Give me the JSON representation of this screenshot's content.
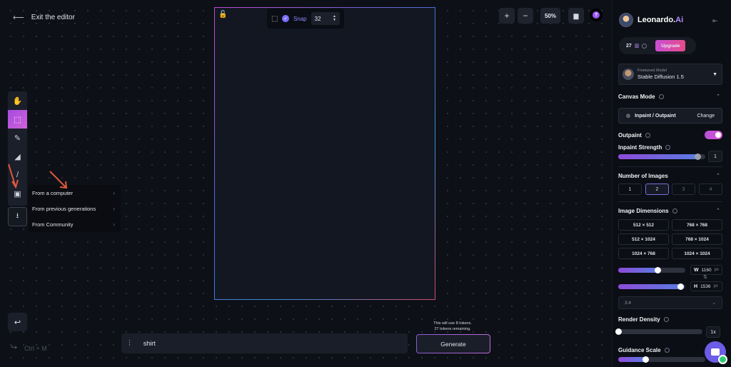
{
  "topbar": {
    "exit_label": "Exit the editor",
    "zoom_in": "+",
    "zoom_out": "−",
    "zoom_level": "50%",
    "help": "?"
  },
  "snap": {
    "label": "Snap",
    "value": "32"
  },
  "popup_menu": {
    "items": [
      "From a computer",
      "From previous generations",
      "From Community"
    ]
  },
  "shortcut_hint": "Ctrl + M",
  "prompt": {
    "value": "shirt"
  },
  "generate": {
    "info_line1": "This will use 8 tokens.",
    "info_line2": "27 tokens remaining.",
    "label": "Generate"
  },
  "sidebar": {
    "brand_main": "Leonardo.",
    "brand_accent": "Ai",
    "tokens": "27",
    "upgrade_label": "Upgrade",
    "model": {
      "caption": "Finetuned Model",
      "name": "Stable Diffusion 1.5"
    },
    "canvas_mode": {
      "title": "Canvas Mode",
      "mode": "Inpaint / Outpaint",
      "change": "Change"
    },
    "outpaint": {
      "label": "Outpaint",
      "enabled": true
    },
    "inpaint_strength": {
      "label": "Inpaint Strength",
      "value": "1",
      "fraction": 0.95
    },
    "number_of_images": {
      "title": "Number of Images",
      "options": [
        "1",
        "2",
        "3",
        "4"
      ],
      "selected": "2"
    },
    "image_dimensions": {
      "title": "Image Dimensions",
      "options": [
        "512 × 512",
        "768 × 768",
        "512 × 1024",
        "768 × 1024",
        "1024 × 768",
        "1024 × 1024"
      ]
    },
    "width": {
      "label": "W",
      "value": "1160",
      "unit": "px",
      "fraction": 0.6
    },
    "height": {
      "label": "H",
      "value": "1536",
      "unit": "px",
      "fraction": 0.98
    },
    "aspect_ratio": "3:4",
    "render_density": {
      "title": "Render Density",
      "value": "1x",
      "fraction": 0.0
    },
    "guidance_scale": {
      "title": "Guidance Scale",
      "fraction": 0.3
    }
  }
}
